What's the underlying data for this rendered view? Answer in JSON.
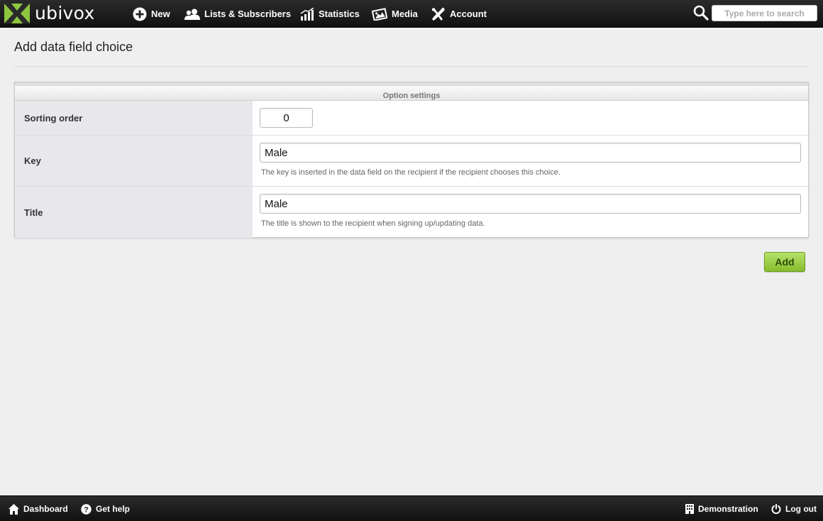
{
  "brand": {
    "name": "ubivox",
    "accent": "#8cc63f"
  },
  "nav": {
    "items": [
      {
        "label": "New",
        "icon": "plus-circle-icon"
      },
      {
        "label": "Lists & Subscribers",
        "icon": "users-icon"
      },
      {
        "label": "Statistics",
        "icon": "bar-chart-icon"
      },
      {
        "label": "Media",
        "icon": "image-icon"
      },
      {
        "label": "Account",
        "icon": "tools-icon"
      }
    ],
    "search": {
      "placeholder": "Type here to search",
      "value": ""
    }
  },
  "page": {
    "title": "Add data field choice",
    "panel_title": "Option settings",
    "fields": [
      {
        "label": "Sorting order",
        "value": "0",
        "help": ""
      },
      {
        "label": "Key",
        "value": "Male",
        "help": "The key is inserted in the data field on the recipient if the recipient chooses this choice."
      },
      {
        "label": "Title",
        "value": "Male",
        "help": "The title is shown to the recipient when signing up/updating data."
      }
    ],
    "submit_label": "Add"
  },
  "footer": {
    "dashboard": "Dashboard",
    "help": "Get help",
    "demonstration": "Demonstration",
    "logout": "Log out"
  }
}
